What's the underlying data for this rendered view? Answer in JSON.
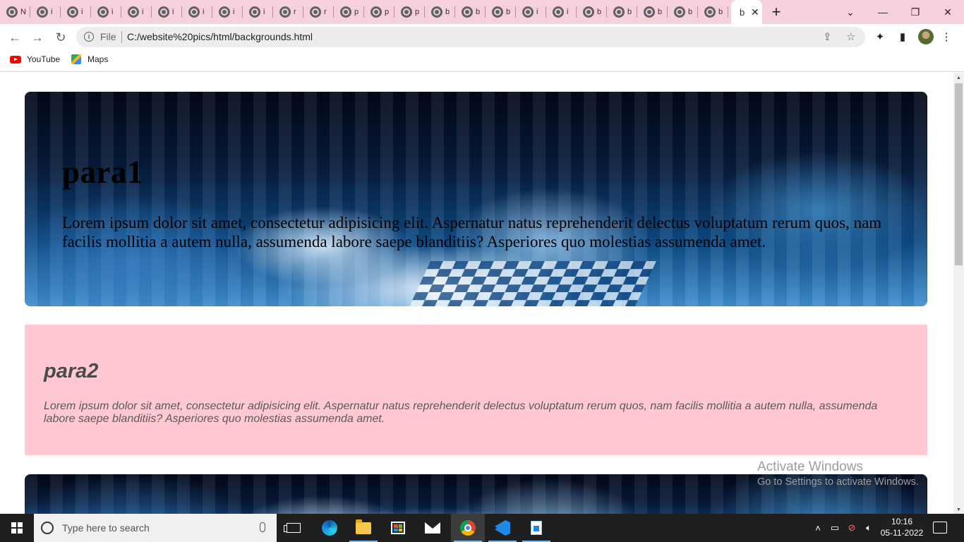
{
  "browser": {
    "tabs": [
      {
        "title": "N"
      },
      {
        "title": "i"
      },
      {
        "title": "i"
      },
      {
        "title": "i"
      },
      {
        "title": "i"
      },
      {
        "title": "i"
      },
      {
        "title": "i"
      },
      {
        "title": "i"
      },
      {
        "title": "i"
      },
      {
        "title": "r"
      },
      {
        "title": "r"
      },
      {
        "title": "p"
      },
      {
        "title": "p"
      },
      {
        "title": "p"
      },
      {
        "title": "b"
      },
      {
        "title": "b"
      },
      {
        "title": "b"
      },
      {
        "title": "i"
      },
      {
        "title": "i"
      },
      {
        "title": "b"
      },
      {
        "title": "b"
      },
      {
        "title": "b"
      },
      {
        "title": "b"
      },
      {
        "title": "b"
      }
    ],
    "active_tab": {
      "title": "b",
      "close": "✕"
    },
    "new_tab": "+",
    "window_controls": {
      "dropdown": "⌄",
      "minimize": "—",
      "restore": "❐",
      "close": "✕"
    },
    "address": {
      "scheme": "File",
      "url": "C:/website%20pics/html/backgrounds.html"
    },
    "bookmarks": [
      {
        "label": "YouTube"
      },
      {
        "label": "Maps"
      }
    ]
  },
  "page": {
    "para1": {
      "title": "para1",
      "text": "Lorem ipsum dolor sit amet, consectetur adipisicing elit. Aspernatur natus reprehenderit delectus voluptatum rerum quos, nam facilis mollitia a autem nulla, assumenda labore saepe blanditiis? Asperiores quo molestias assumenda amet."
    },
    "para2": {
      "title": "para2",
      "text": "Lorem ipsum dolor sit amet, consectetur adipisicing elit. Aspernatur natus reprehenderit delectus voluptatum rerum quos, nam facilis mollitia a autem nulla, assumenda labore saepe blanditiis? Asperiores quo molestias assumenda amet."
    },
    "para2_background": "#ffc8d2"
  },
  "watermark": {
    "line1": "Activate Windows",
    "line2": "Go to Settings to activate Windows."
  },
  "taskbar": {
    "search_placeholder": "Type here to search",
    "apps": [
      "task-view-icon",
      "edge-icon",
      "file-explorer-icon",
      "store-icon",
      "mail-icon",
      "chrome-icon",
      "vscode-icon",
      "paint-icon"
    ],
    "time": "10:16",
    "date": "05-11-2022"
  }
}
